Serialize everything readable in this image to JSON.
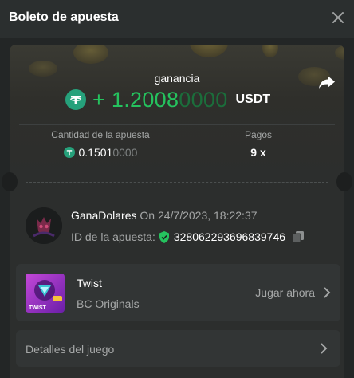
{
  "header": {
    "title": "Boleto de apuesta",
    "close_icon": "close-icon"
  },
  "ticket": {
    "winnings_label": "ganancia",
    "amount_sign": "+",
    "amount_bright": "1.2008",
    "amount_dim": "0000",
    "currency": "USDT",
    "share_icon": "share-icon",
    "bet_amount_label": "Cantidad de la apuesta",
    "bet_amount_bright": "0.1501",
    "bet_amount_dim": "0000",
    "payout_label": "Pagos",
    "payout_value": "9 x"
  },
  "bet_info": {
    "username": "GanaDolares",
    "date_text": "On 24/7/2023, 18:22:37",
    "bet_id_label": "ID de la apuesta:",
    "bet_id": "3280622936968397​46"
  },
  "game": {
    "name": "Twist",
    "provider": "BC Originals",
    "play_label": "Jugar ahora",
    "thumb_text": "TWIST"
  },
  "details": {
    "label": "Detalles del juego"
  },
  "colors": {
    "accent_green": "#25c25e",
    "background": "#232626",
    "card": "#323535"
  }
}
